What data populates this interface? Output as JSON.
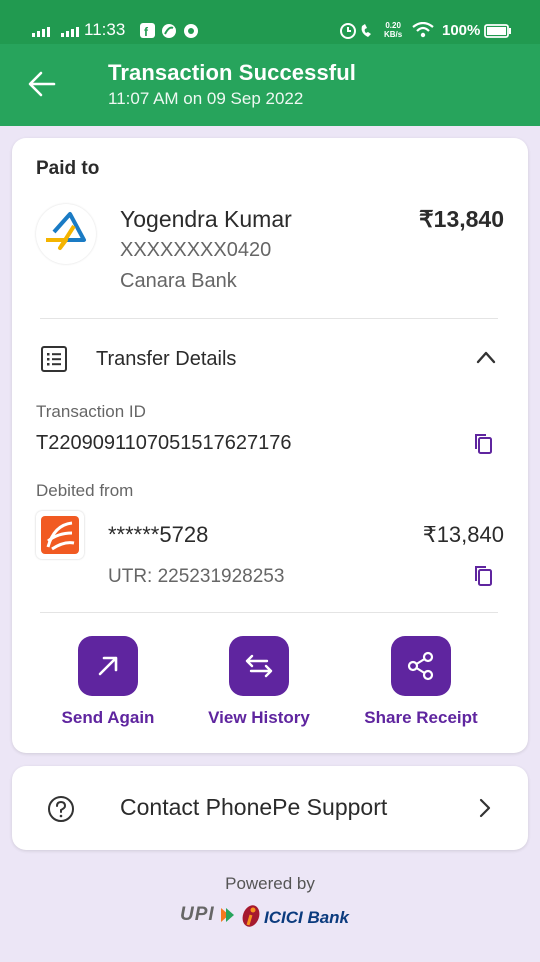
{
  "status_bar": {
    "time": "11:33",
    "network_speed_top": "0.20",
    "network_speed_bottom": "KB/s",
    "battery": "100%"
  },
  "header": {
    "title": "Transaction Successful",
    "subtitle": "11:07 AM on 09 Sep 2022"
  },
  "paid_to": {
    "heading": "Paid to",
    "name": "Yogendra Kumar",
    "account": "XXXXXXXX0420",
    "bank": "Canara Bank",
    "amount": "₹13,840"
  },
  "transfer_details": {
    "heading": "Transfer Details",
    "transaction_id_label": "Transaction ID",
    "transaction_id": "T2209091107051517627176",
    "debited_from_label": "Debited from",
    "debit_account": "******5728",
    "debit_amount": "₹13,840",
    "utr": "UTR: 225231928253"
  },
  "actions": [
    {
      "label": "Send Again",
      "icon": "arrow-up-right-icon"
    },
    {
      "label": "View History",
      "icon": "swap-arrows-icon"
    },
    {
      "label": "Share Receipt",
      "icon": "share-icon"
    }
  ],
  "support": {
    "label": "Contact PhonePe Support"
  },
  "footer": {
    "powered_by": "Powered by",
    "logo_upi": "UPI",
    "logo_icici": "ICICI Bank"
  },
  "colors": {
    "header_green": "#27a45c",
    "status_green": "#219a50",
    "brand_purple": "#5f259f",
    "page_bg": "#ece6f6"
  }
}
